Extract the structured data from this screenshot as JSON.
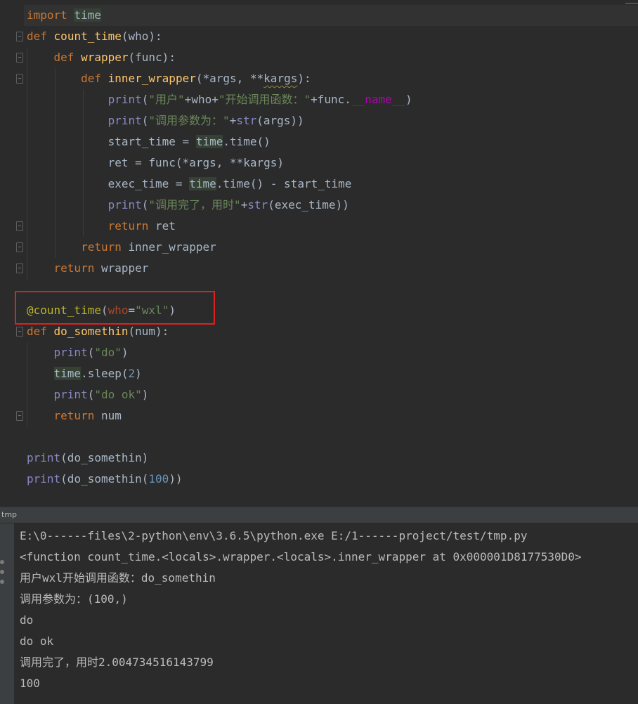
{
  "editor": {
    "lines": [
      [
        [
          "kw",
          "import"
        ],
        [
          "plain",
          " "
        ],
        [
          "hl",
          "time"
        ]
      ],
      [
        [
          "kw",
          "def"
        ],
        [
          "plain",
          " "
        ],
        [
          "fn",
          "count_time"
        ],
        [
          "plain",
          "("
        ],
        [
          "plain",
          "who"
        ],
        [
          "plain",
          "):"
        ]
      ],
      [
        [
          "plain",
          "    "
        ],
        [
          "kw",
          "def"
        ],
        [
          "plain",
          " "
        ],
        [
          "fn",
          "wrapper"
        ],
        [
          "plain",
          "(func):"
        ]
      ],
      [
        [
          "plain",
          "        "
        ],
        [
          "kw",
          "def"
        ],
        [
          "plain",
          " "
        ],
        [
          "fn",
          "inner_wrapper"
        ],
        [
          "plain",
          "(*args, **"
        ],
        [
          "squig",
          "kargs"
        ],
        [
          "plain",
          "):"
        ]
      ],
      [
        [
          "plain",
          "            "
        ],
        [
          "bi",
          "print"
        ],
        [
          "plain",
          "("
        ],
        [
          "str",
          "\"用户\""
        ],
        [
          "plain",
          "+who+"
        ],
        [
          "str",
          "\"开始调用函数：\""
        ],
        [
          "plain",
          "+func."
        ],
        [
          "dunder",
          "__name__"
        ],
        [
          "plain",
          ")"
        ]
      ],
      [
        [
          "plain",
          "            "
        ],
        [
          "bi",
          "print"
        ],
        [
          "plain",
          "("
        ],
        [
          "str",
          "\"调用参数为：\""
        ],
        [
          "plain",
          "+"
        ],
        [
          "bi",
          "str"
        ],
        [
          "plain",
          "(args))"
        ]
      ],
      [
        [
          "plain",
          "            start_time = "
        ],
        [
          "hl",
          "time"
        ],
        [
          "plain",
          ".time()"
        ]
      ],
      [
        [
          "plain",
          "            ret = func(*args, **kargs)"
        ]
      ],
      [
        [
          "plain",
          "            exec_time = "
        ],
        [
          "hl",
          "time"
        ],
        [
          "plain",
          ".time() - start_time"
        ]
      ],
      [
        [
          "plain",
          "            "
        ],
        [
          "bi",
          "print"
        ],
        [
          "plain",
          "("
        ],
        [
          "str",
          "\"调用完了，用时\""
        ],
        [
          "plain",
          "+"
        ],
        [
          "bi",
          "str"
        ],
        [
          "plain",
          "(exec_time))"
        ]
      ],
      [
        [
          "plain",
          "            "
        ],
        [
          "kw",
          "return"
        ],
        [
          "plain",
          " ret"
        ]
      ],
      [
        [
          "plain",
          "        "
        ],
        [
          "kw",
          "return"
        ],
        [
          "plain",
          " inner_wrapper"
        ]
      ],
      [
        [
          "plain",
          "    "
        ],
        [
          "kw",
          "return"
        ],
        [
          "plain",
          " wrapper"
        ]
      ],
      [],
      [
        [
          "dec",
          "@count_time"
        ],
        [
          "plain",
          "("
        ],
        [
          "param",
          "who"
        ],
        [
          "plain",
          "="
        ],
        [
          "str",
          "\"wxl\""
        ],
        [
          "plain",
          ")"
        ]
      ],
      [
        [
          "kw",
          "def"
        ],
        [
          "plain",
          " "
        ],
        [
          "fn",
          "do_somethin"
        ],
        [
          "plain",
          "(num):"
        ]
      ],
      [
        [
          "plain",
          "    "
        ],
        [
          "bi",
          "print"
        ],
        [
          "plain",
          "("
        ],
        [
          "str",
          "\"do\""
        ],
        [
          "plain",
          ")"
        ]
      ],
      [
        [
          "plain",
          "    "
        ],
        [
          "hl",
          "time"
        ],
        [
          "plain",
          ".sleep("
        ],
        [
          "num",
          "2"
        ],
        [
          "plain",
          ")"
        ]
      ],
      [
        [
          "plain",
          "    "
        ],
        [
          "bi",
          "print"
        ],
        [
          "plain",
          "("
        ],
        [
          "str",
          "\"do ok\""
        ],
        [
          "plain",
          ")"
        ]
      ],
      [
        [
          "plain",
          "    "
        ],
        [
          "kw",
          "return"
        ],
        [
          "plain",
          " num"
        ]
      ],
      [],
      [
        [
          "bi",
          "print"
        ],
        [
          "plain",
          "(do_somethin)"
        ]
      ],
      [
        [
          "bi",
          "print"
        ],
        [
          "plain",
          "(do_somethin("
        ],
        [
          "num",
          "100"
        ],
        [
          "plain",
          "))"
        ]
      ]
    ]
  },
  "run_tab": {
    "label": "tmp"
  },
  "console": {
    "lines": [
      "E:\\0------files\\2-python\\env\\3.6.5\\python.exe E:/1------project/test/tmp.py",
      "<function count_time.<locals>.wrapper.<locals>.inner_wrapper at 0x000001D8177530D0>",
      "用户wxl开始调用函数：do_somethin",
      "调用参数为：(100,)",
      "do",
      "do ok",
      "调用完了，用时2.004734516143799",
      "100"
    ]
  },
  "colors": {
    "keyword": "#cc7832",
    "function": "#ffc66d",
    "builtin": "#8888c6",
    "string": "#6a8759",
    "number": "#6897bb",
    "decorator": "#bbb529",
    "highlight_box": "#e0201e"
  },
  "icons": [
    "fold-marker-icon",
    "run-side-icon"
  ]
}
